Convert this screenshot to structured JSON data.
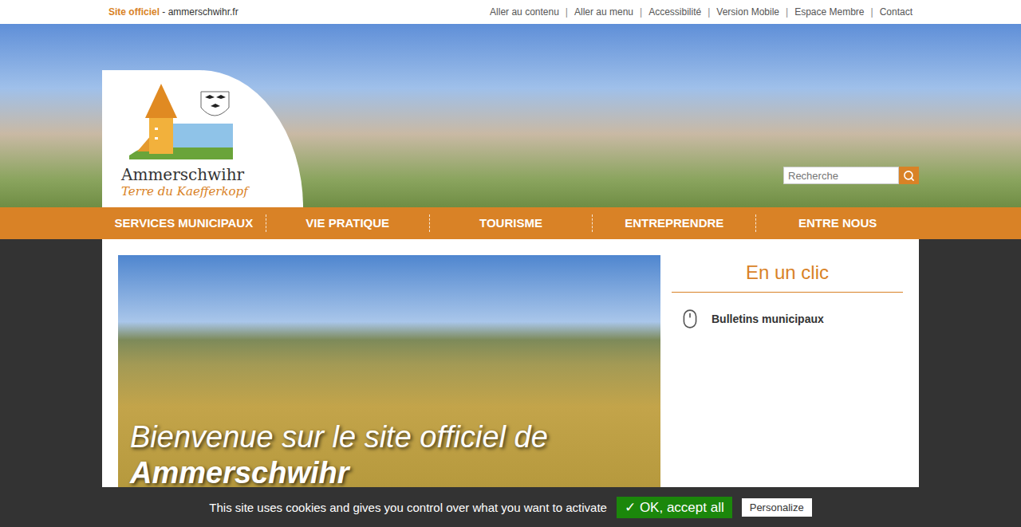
{
  "topbar": {
    "site_label": "Site officiel",
    "site_separator": " - ",
    "site_domain": "ammerschwihr.fr",
    "link_separator": "|",
    "links": [
      "Aller au contenu",
      "Aller au menu",
      "Accessibilité",
      "Version Mobile",
      "Espace Membre",
      "Contact"
    ]
  },
  "logo": {
    "name": "Ammerschwihr",
    "tagline": "Terre du Kaefferkopf"
  },
  "search": {
    "placeholder": "Recherche"
  },
  "nav": [
    {
      "label": "SERVICES MUNICIPAUX"
    },
    {
      "label": "VIE PRATIQUE"
    },
    {
      "label": "TOURISME"
    },
    {
      "label": "ENTREPRENDRE"
    },
    {
      "label": "ENTRE NOUS"
    }
  ],
  "hero": {
    "line1": "Bienvenue sur le site officiel de",
    "line2": "Ammerschwihr"
  },
  "sidebar": {
    "title": "En un clic",
    "items": [
      {
        "label": "Bulletins municipaux"
      }
    ]
  },
  "cookie_bar": {
    "message": "This site uses cookies and gives you control over what you want to activate",
    "buttons": [
      {
        "label": "✓ OK, accept all",
        "kind": "primary"
      },
      {
        "label": "Personalize",
        "kind": "secondary"
      }
    ]
  }
}
